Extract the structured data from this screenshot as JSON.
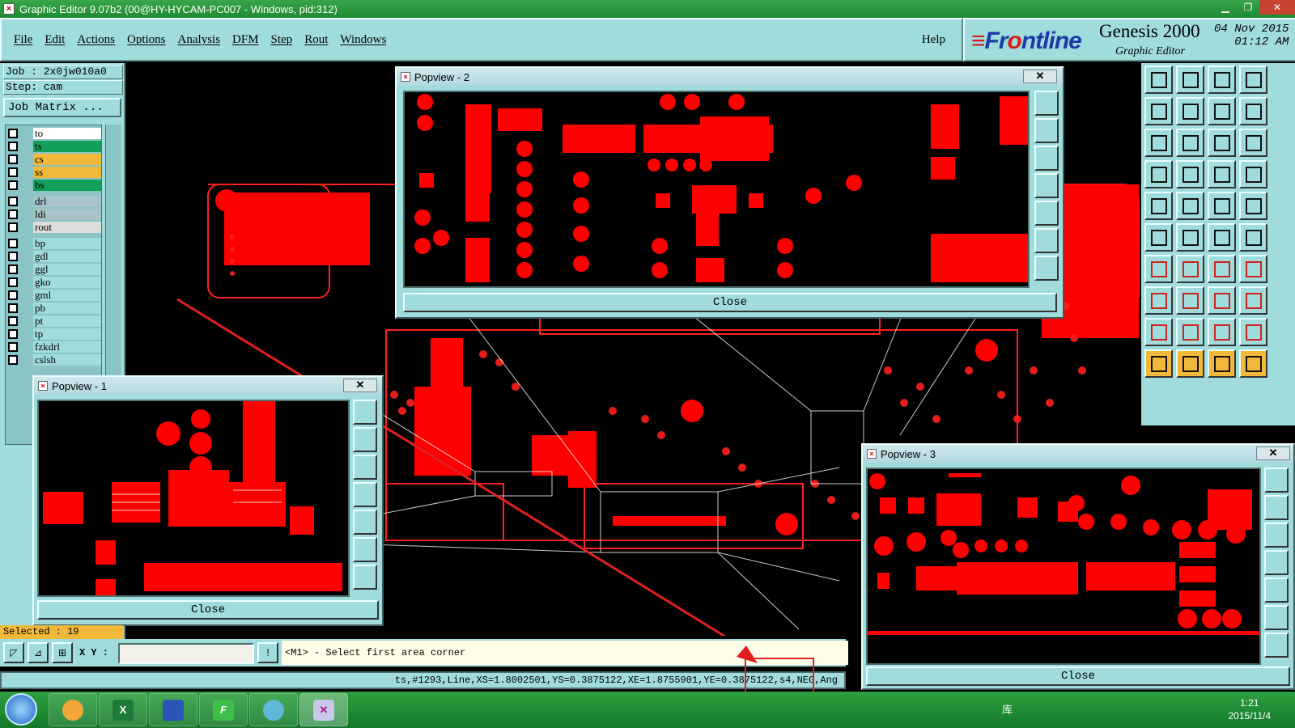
{
  "window": {
    "title": "Graphic Editor 9.07b2 (00@HY-HYCAM-PC007 - Windows, pid:312)"
  },
  "menu": {
    "items": [
      "File",
      "Edit",
      "Actions",
      "Options",
      "Analysis",
      "DFM",
      "Step",
      "Rout",
      "Windows"
    ],
    "help": "Help"
  },
  "brand": {
    "logo_a": "F",
    "logo_b": "r",
    "logo_c": "ntline",
    "product": "Genesis 2000",
    "subtitle": "Graphic Editor",
    "date": "04 Nov 2015",
    "time": "01:12 AM"
  },
  "left": {
    "job": "Job : 2x0jw010a0",
    "step": "Step: cam",
    "job_matrix": "Job Matrix ...",
    "selected": "Selected : 19",
    "layers": [
      {
        "name": "to",
        "color": "#ffffff"
      },
      {
        "name": "ts",
        "color": "#12a05a"
      },
      {
        "name": "cs",
        "color": "#f2b83a"
      },
      {
        "name": "ss",
        "color": "#f2b83a"
      },
      {
        "name": "bs",
        "color": "#12a05a"
      },
      {
        "name": "drl",
        "color": "#a9c4c8"
      },
      {
        "name": "ldi",
        "color": "#a9c4c8"
      },
      {
        "name": "rout",
        "color": "#dcdcdc"
      },
      {
        "name": "bp",
        "color": "#a0dcdc"
      },
      {
        "name": "gdl",
        "color": "#a0dcdc"
      },
      {
        "name": "ggl",
        "color": "#a0dcdc"
      },
      {
        "name": "gko",
        "color": "#a0dcdc"
      },
      {
        "name": "gml",
        "color": "#a0dcdc"
      },
      {
        "name": "pb",
        "color": "#a0dcdc"
      },
      {
        "name": "pt",
        "color": "#a0dcdc"
      },
      {
        "name": "tp",
        "color": "#a0dcdc"
      },
      {
        "name": "fzkdrl",
        "color": "#a0dcdc"
      },
      {
        "name": "cslsh",
        "color": "#a0dcdc"
      }
    ]
  },
  "popups": [
    {
      "title": "Popview - 2",
      "close_label": "Close"
    },
    {
      "title": "Popview - 1",
      "close_label": "Close"
    },
    {
      "title": "Popview - 3",
      "close_label": "Close"
    }
  ],
  "command": {
    "xy_label": "X Y :",
    "xy_value": "",
    "prompt": "<M1> - Select first area corner"
  },
  "status": {
    "info": "ts,#1293,Line,XS=1.8002501,YS=0.3875122,XE=1.8755901,YE=0.3875122,s4,NEG,Ang"
  },
  "taskbar": {
    "tray_text": "库",
    "time": "1:21",
    "date": "2015/11/4"
  },
  "colors": {
    "panel": "#a0dcdc",
    "copper": "#ff0000",
    "highlight": "#f2b83a"
  }
}
